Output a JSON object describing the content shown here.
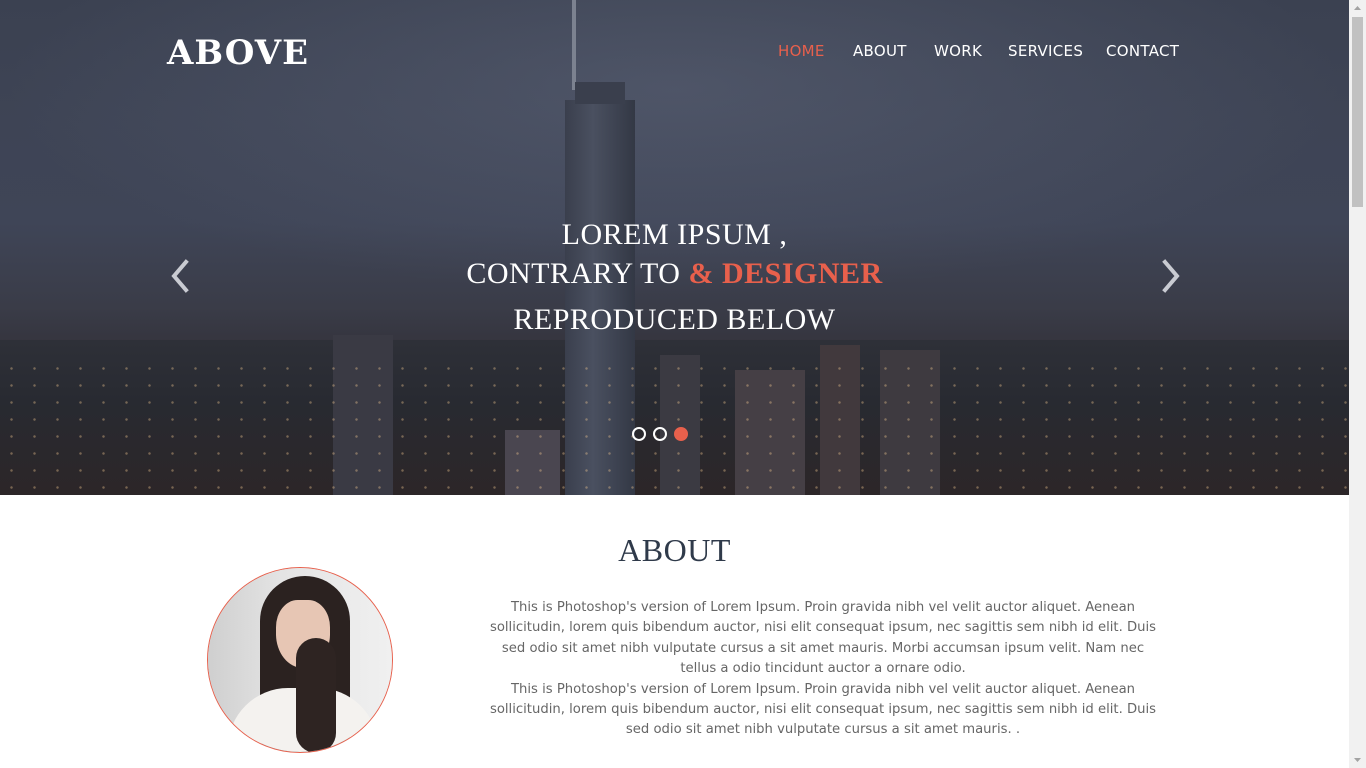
{
  "brand": {
    "logo": "ABOVE"
  },
  "nav": {
    "items": [
      {
        "label": "HOME",
        "active": true
      },
      {
        "label": "ABOUT",
        "active": false
      },
      {
        "label": "WORK",
        "active": false
      },
      {
        "label": "SERVICES",
        "active": false
      },
      {
        "label": "CONTACT",
        "active": false
      }
    ]
  },
  "hero": {
    "line1": "LOREM IPSUM ,",
    "line2_prefix": "CONTRARY TO",
    "line2_accent": "& DESIGNER",
    "line3": "REPRODUCED BELOW",
    "active_slide": 3,
    "slide_count": 3,
    "prev_icon": "chevron-left-icon",
    "next_icon": "chevron-right-icon"
  },
  "about": {
    "title": "ABOUT",
    "paragraph1": "This is Photoshop's version of Lorem Ipsum. Proin gravida nibh vel velit auctor aliquet. Aenean sollicitudin, lorem quis bibendum auctor, nisi elit consequat ipsum, nec sagittis sem nibh id elit. Duis sed odio sit amet nibh vulputate cursus a sit amet mauris. Morbi accumsan ipsum velit. Nam nec tellus a odio tincidunt auctor a ornare odio.",
    "paragraph2": "This is Photoshop's version of Lorem Ipsum. Proin gravida nibh vel velit auctor aliquet. Aenean sollicitudin, lorem quis bibendum auctor, nisi elit consequat ipsum, nec sagittis sem nibh id elit. Duis sed odio sit amet nibh vulputate cursus a sit amet mauris. ."
  },
  "colors": {
    "accent": "#e8604c",
    "heading": "#2f3a4a",
    "body_text": "#666666"
  }
}
